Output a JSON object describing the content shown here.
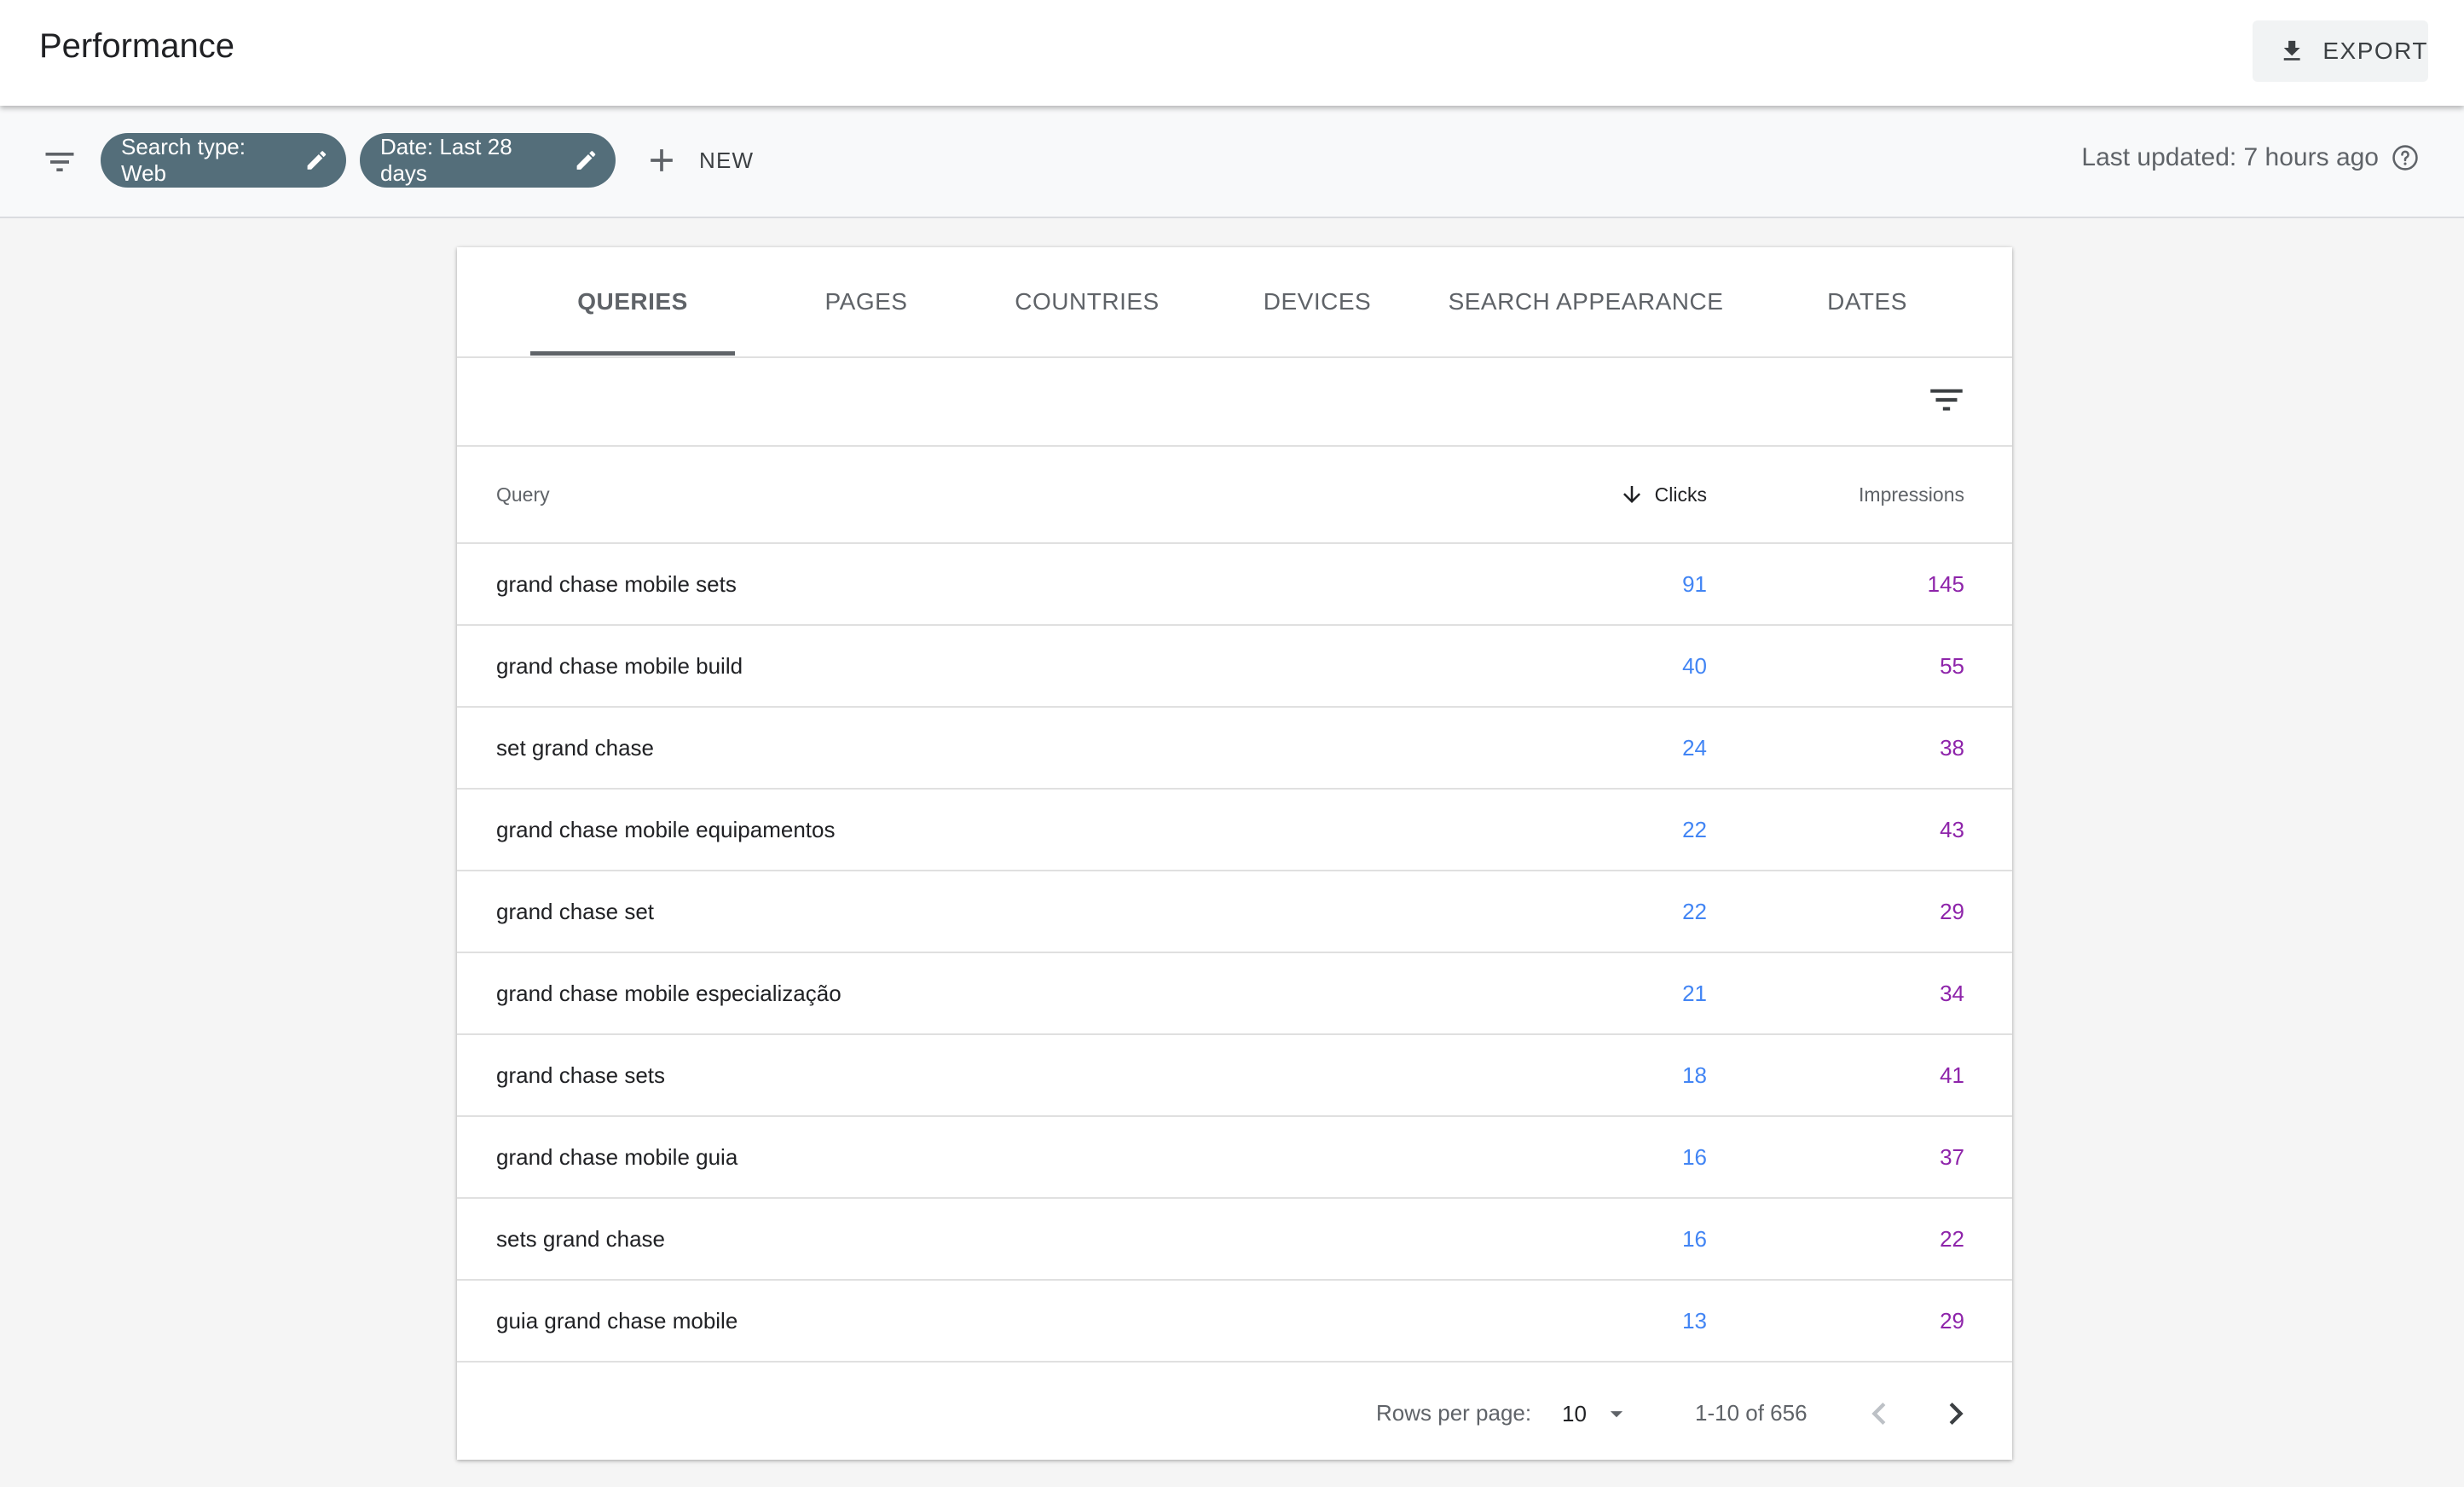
{
  "header": {
    "title": "Performance",
    "export_label": "EXPORT"
  },
  "filter_bar": {
    "chips": [
      {
        "label": "Search type: Web"
      },
      {
        "label": "Date: Last 28 days"
      }
    ],
    "new_label": "NEW",
    "last_updated": "Last updated: 7 hours ago"
  },
  "tabs": [
    {
      "label": "QUERIES",
      "active": true
    },
    {
      "label": "PAGES"
    },
    {
      "label": "COUNTRIES"
    },
    {
      "label": "DEVICES"
    },
    {
      "label": "SEARCH APPEARANCE"
    },
    {
      "label": "DATES"
    }
  ],
  "table": {
    "columns": {
      "query": "Query",
      "clicks": "Clicks",
      "impressions": "Impressions"
    },
    "sorted_by": "Clicks",
    "rows": [
      {
        "query": "grand chase mobile sets",
        "clicks": "91",
        "impressions": "145"
      },
      {
        "query": "grand chase mobile build",
        "clicks": "40",
        "impressions": "55"
      },
      {
        "query": "set grand chase",
        "clicks": "24",
        "impressions": "38"
      },
      {
        "query": "grand chase mobile equipamentos",
        "clicks": "22",
        "impressions": "43"
      },
      {
        "query": "grand chase set",
        "clicks": "22",
        "impressions": "29"
      },
      {
        "query": "grand chase mobile especialização",
        "clicks": "21",
        "impressions": "34"
      },
      {
        "query": "grand chase sets",
        "clicks": "18",
        "impressions": "41"
      },
      {
        "query": "grand chase mobile guia",
        "clicks": "16",
        "impressions": "37"
      },
      {
        "query": "sets grand chase",
        "clicks": "16",
        "impressions": "22"
      },
      {
        "query": "guia grand chase mobile",
        "clicks": "13",
        "impressions": "29"
      }
    ]
  },
  "pagination": {
    "rows_per_page_label": "Rows per page:",
    "rows_per_page": "10",
    "range": "1-10 of 656"
  },
  "colors": {
    "clicks": "#4285f4",
    "impressions": "#8e24aa",
    "chip_bg": "#546e7a"
  },
  "icons": [
    "download-icon",
    "filter-icon",
    "edit-icon",
    "plus-icon",
    "help-icon",
    "arrow-down-icon",
    "dropdown-icon",
    "chevron-left-icon",
    "chevron-right-icon"
  ]
}
